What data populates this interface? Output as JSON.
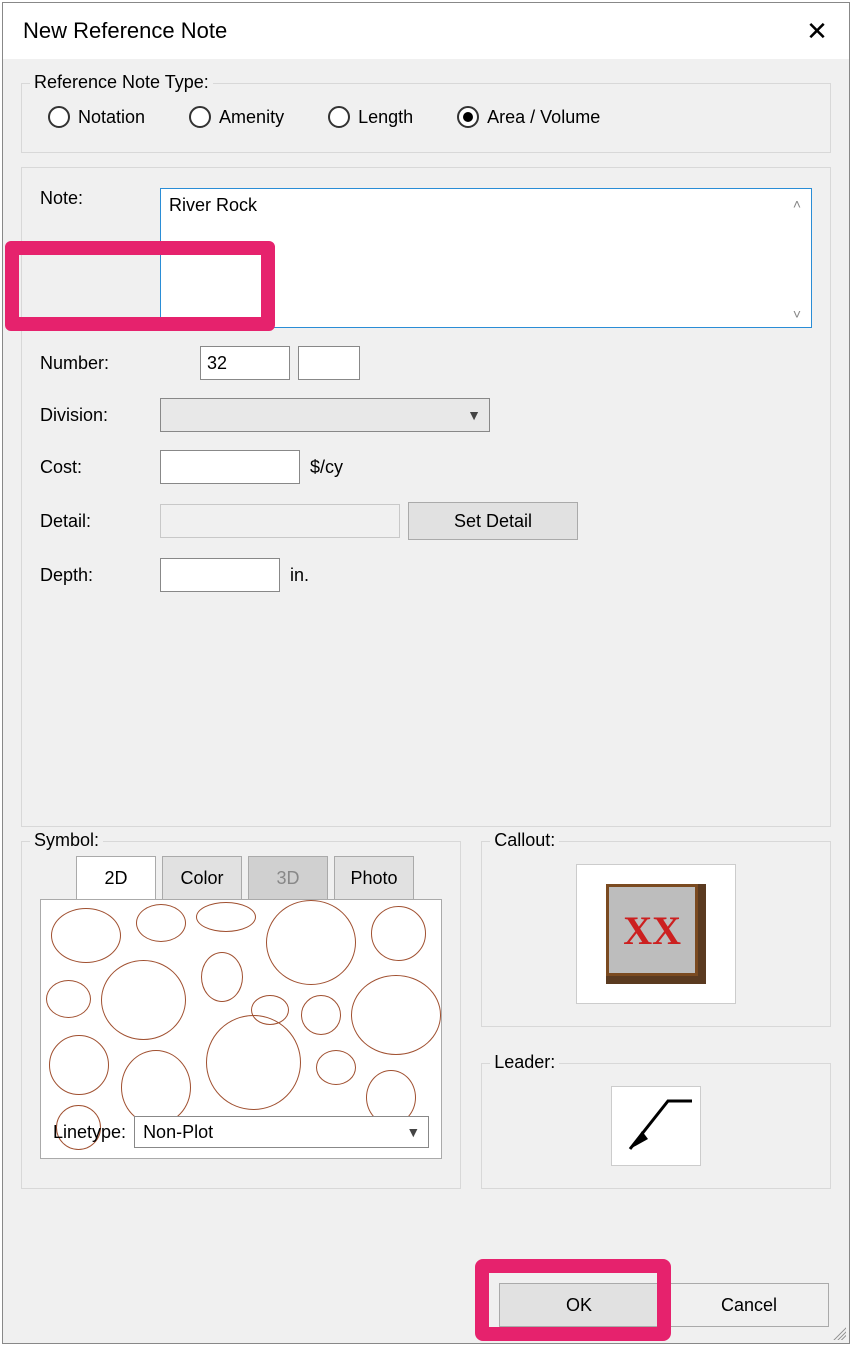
{
  "title": "New Reference Note",
  "type_group": {
    "legend": "Reference Note Type:",
    "options": [
      {
        "label": "Notation",
        "selected": false
      },
      {
        "label": "Amenity",
        "selected": false
      },
      {
        "label": "Length",
        "selected": false
      },
      {
        "label": "Area / Volume",
        "selected": true
      }
    ]
  },
  "fields": {
    "note_label": "Note:",
    "note_value": "River Rock",
    "number_label": "Number:",
    "number_value": "32",
    "number_suffix_value": "",
    "division_label": "Division:",
    "division_value": "",
    "cost_label": "Cost:",
    "cost_value": "",
    "cost_unit": "$/cy",
    "detail_label": "Detail:",
    "detail_value": "",
    "set_detail_btn": "Set Detail",
    "depth_label": "Depth:",
    "depth_value": "",
    "depth_unit": "in."
  },
  "symbol": {
    "legend": "Symbol:",
    "tabs": {
      "twoD": "2D",
      "color": "Color",
      "threeD": "3D",
      "photo": "Photo"
    },
    "active_tab": "2D",
    "linetype_label": "Linetype:",
    "linetype_value": "Non-Plot"
  },
  "callout": {
    "legend": "Callout:",
    "placeholder": "XX"
  },
  "leader": {
    "legend": "Leader:"
  },
  "footer": {
    "ok": "OK",
    "cancel": "Cancel"
  }
}
